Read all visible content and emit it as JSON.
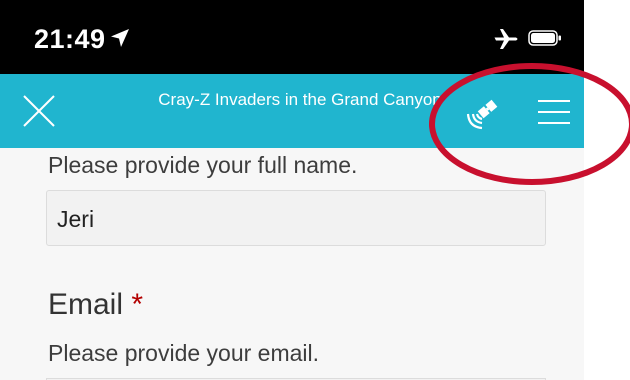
{
  "status_bar": {
    "time": "21:49",
    "icons": [
      "location-arrow-icon",
      "airplane-mode-icon",
      "battery-icon"
    ]
  },
  "nav": {
    "title": "Cray-Z Invaders in the Grand Canyon",
    "close_icon": "close-icon",
    "satellite_icon": "satellite-icon",
    "menu_icon": "hamburger-menu-icon",
    "bar_color": "#20b5cf"
  },
  "form": {
    "name_hint": "Please provide your full name.",
    "name_value": "Jeri",
    "email_label": "Email",
    "email_required_marker": "*",
    "email_hint": "Please provide your email."
  },
  "annotation": {
    "color": "#c8102e",
    "shape": "ellipse-around-satellite-and-menu-icons"
  }
}
